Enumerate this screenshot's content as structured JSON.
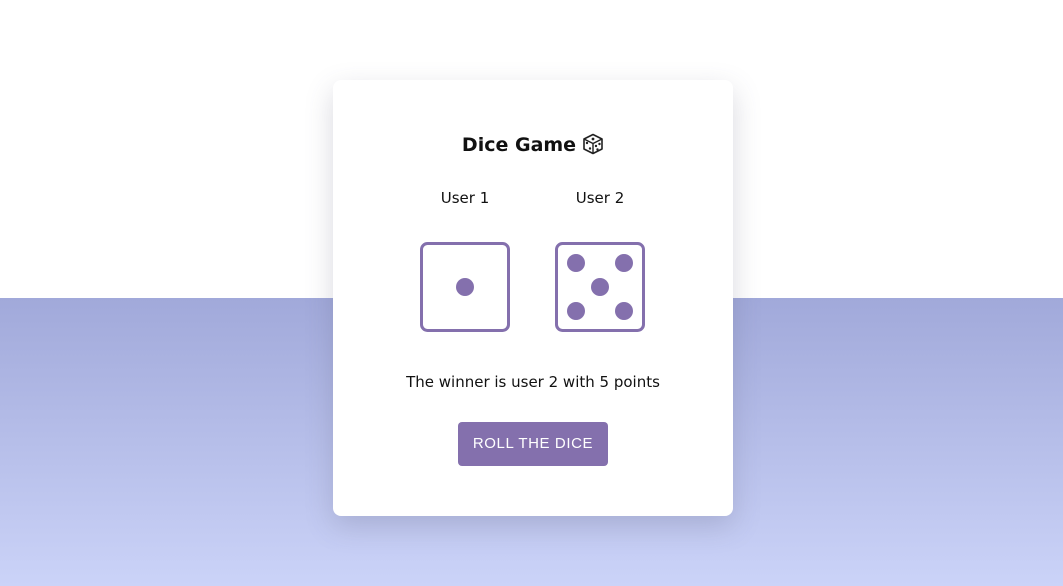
{
  "game": {
    "title": "Dice Game",
    "title_icon": "game-die-icon",
    "players": [
      {
        "label": "User 1",
        "die_value": 1
      },
      {
        "label": "User 2",
        "die_value": 5
      }
    ],
    "result_text": "The winner is user 2 with 5 points",
    "roll_button_label": "ROLL THE DICE"
  },
  "colors": {
    "accent": "#8470ad",
    "background_bottom_start": "#a1a9da",
    "background_bottom_end": "#cbd3f8",
    "card": "#ffffff"
  }
}
